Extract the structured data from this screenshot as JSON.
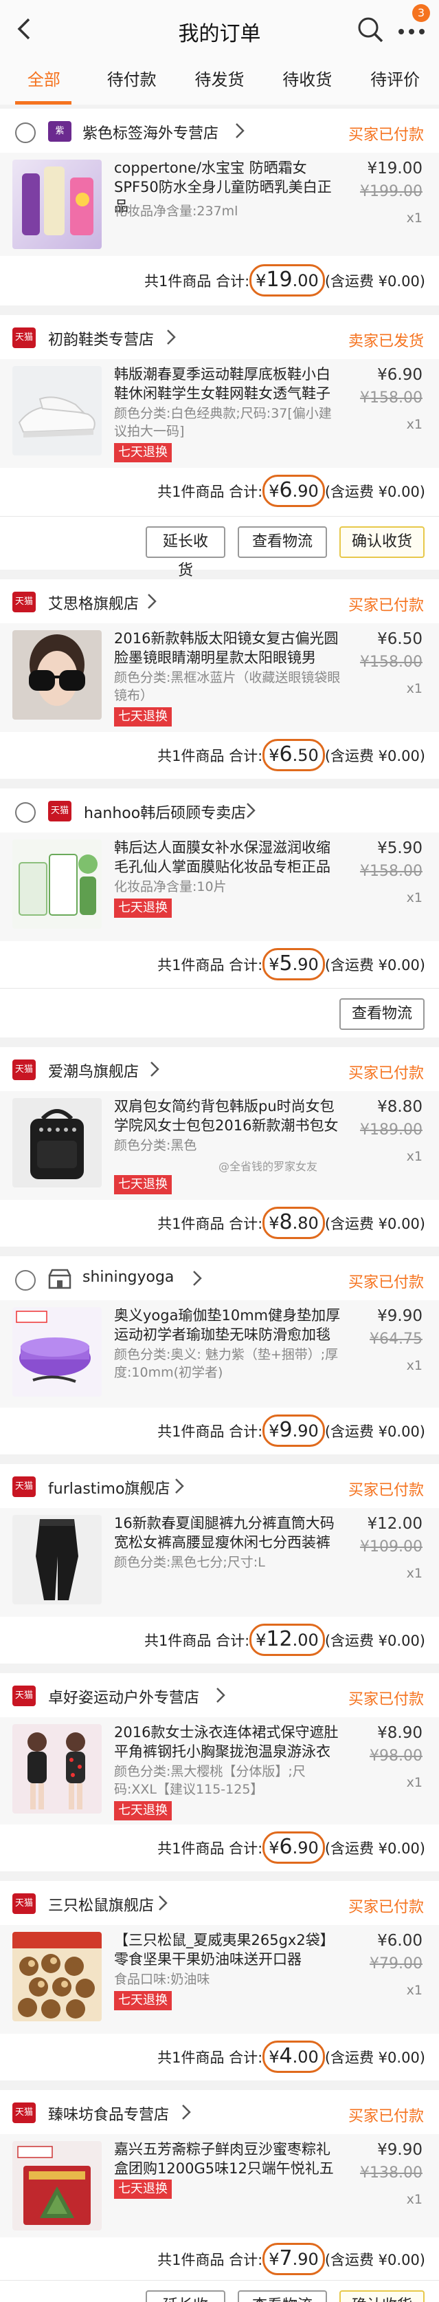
{
  "header": {
    "title": "我的订单",
    "badge": "3"
  },
  "tabs": [
    "全部",
    "待付款",
    "待发货",
    "待收货",
    "待评价"
  ],
  "summary": {
    "prefix": "共1件商品 合计:",
    "yen": "¥",
    "suffix": "(含运费 ¥0.00)"
  },
  "orders": [
    {
      "shop": "紫色标签海外专营店",
      "status": "买家已付款",
      "logo": "紫",
      "title": "coppertone/水宝宝 防晒霜女SPF50防水全身儿童防晒乳美白正品",
      "spec": "化妆品净含量:237ml",
      "price": "¥19.00",
      "old": "¥199.00",
      "qty": "x1",
      "tag": "",
      "total_int": "19",
      "total_dec": ".00"
    },
    {
      "shop": "初韵鞋类专营店",
      "status": "卖家已发货",
      "logo": "天猫",
      "title": "韩版潮春夏季运动鞋厚底板鞋小白鞋休闲鞋学生女鞋网鞋女透气鞋子",
      "spec": "颜色分类:白色经典款;尺码:37[偏小建议拍大一码]",
      "price": "¥6.90",
      "old": "¥158.00",
      "qty": "x1",
      "tag": "七天退换",
      "total_int": "6",
      "total_dec": ".90",
      "buttons": [
        "延长收货",
        "查看物流",
        "确认收货"
      ]
    },
    {
      "shop": "艾思格旗舰店",
      "status": "买家已付款",
      "logo": "天猫",
      "title": "2016新款韩版太阳镜女复古偏光圆脸墨镜眼睛潮明星款太阳眼镜男",
      "spec": "颜色分类:黑框冰蓝片（收藏送眼镜袋眼镜布）",
      "price": "¥6.50",
      "old": "¥158.00",
      "qty": "x1",
      "tag": "七天退换",
      "total_int": "6",
      "total_dec": ".50"
    },
    {
      "shop": "hanhoo韩后硕顾专卖店",
      "status": "",
      "logo": "天猫",
      "title": "韩后达人面膜女补水保湿滋润收缩毛孔仙人掌面膜贴化妆品专柜正品",
      "spec": "化妆品净含量:10片",
      "price": "¥5.90",
      "old": "¥158.00",
      "qty": "x1",
      "tag": "七天退换",
      "total_int": "5",
      "total_dec": ".90",
      "buttons": [
        "查看物流"
      ]
    },
    {
      "shop": "爱潮鸟旗舰店",
      "status": "买家已付款",
      "logo": "天猫",
      "title": "双肩包女简约背包韩版pu时尚女包学院风女士包包2016新款潮书包女",
      "spec": "颜色分类:黑色",
      "price": "¥8.80",
      "old": "¥189.00",
      "qty": "x1",
      "tag": "七天退换",
      "total_int": "8",
      "total_dec": ".80",
      "watermark": "@全省钱的罗家女友"
    },
    {
      "shop": "shiningyoga",
      "status": "买家已付款",
      "logo": "",
      "title": "奥义yoga瑜伽垫10mm健身垫加厚运动初学者瑜珈垫无味防滑愈加毯",
      "spec": "颜色分类:奥义: 魅力紫（垫+捆带）;厚度:10mm(初学者)",
      "price": "¥9.90",
      "old": "¥64.75",
      "qty": "x1",
      "tag": "",
      "total_int": "9",
      "total_dec": ".90"
    },
    {
      "shop": "furlastimo旗舰店",
      "status": "买家已付款",
      "logo": "天猫",
      "title": "16新款春夏闺腿裤九分裤直筒大码宽松女裤高腰显瘦休闲七分西装裤",
      "spec": "颜色分类:黑色七分;尺寸:L",
      "price": "¥12.00",
      "old": "¥109.00",
      "qty": "x1",
      "tag": "",
      "total_int": "12",
      "total_dec": ".00"
    },
    {
      "shop": "卓好姿运动户外专营店",
      "status": "买家已付款",
      "logo": "天猫",
      "title": "2016款女士泳衣连体裙式保守遮肚平角裤钢托小胸聚拢泡温泉游泳衣",
      "spec": "颜色分类:黑大樱桃【分体版】;尺码:XXL【建议115-125】",
      "price": "¥8.90",
      "old": "¥98.00",
      "qty": "x1",
      "tag": "七天退换",
      "total_int": "6",
      "total_dec": ".90"
    },
    {
      "shop": "三只松鼠旗舰店",
      "status": "买家已付款",
      "logo": "天猫",
      "title": "【三只松鼠_夏威夷果265gx2袋】零食坚果干果奶油味送开口器",
      "spec": "食品口味:奶油味",
      "price": "¥6.00",
      "old": "¥79.00",
      "qty": "x1",
      "tag": "七天退换",
      "total_int": "4",
      "total_dec": ".00"
    },
    {
      "shop": "臻味坊食品专营店",
      "status": "买家已付款",
      "logo": "天猫",
      "title": "嘉兴五芳斋粽子鲜肉豆沙蜜枣粽礼盒团购1200G5味12只端午悦礼五芳",
      "spec": "",
      "price": "¥9.90",
      "old": "¥138.00",
      "qty": "x1",
      "tag": "七天退换",
      "total_int": "7",
      "total_dec": ".90",
      "buttons": [
        "延长收货",
        "查看物流",
        "确认收货"
      ]
    }
  ],
  "colors": {
    "accent": "#f5731f",
    "tmall": "#c81623",
    "tag": "#e4393c"
  }
}
